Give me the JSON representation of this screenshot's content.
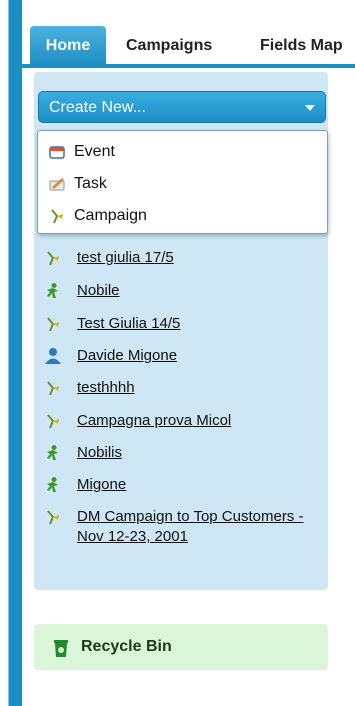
{
  "tabs": [
    {
      "label": "Home"
    },
    {
      "label": "Campaigns"
    },
    {
      "label": "Fields Map"
    }
  ],
  "create_new": {
    "label": "Create New...",
    "options": [
      {
        "label": "Event",
        "icon": "calendar-icon"
      },
      {
        "label": "Task",
        "icon": "task-pencil-icon"
      },
      {
        "label": "Campaign",
        "icon": "campaign-icon"
      }
    ]
  },
  "recent_items": [
    {
      "label": "test giulia 17/5",
      "icon": "campaign-icon"
    },
    {
      "label": "Nobile",
      "icon": "lead-icon"
    },
    {
      "label": "Test Giulia 14/5",
      "icon": "campaign-icon"
    },
    {
      "label": "Davide Migone",
      "icon": "contact-icon"
    },
    {
      "label": "testhhhh",
      "icon": "campaign-icon"
    },
    {
      "label": "Campagna prova Micol",
      "icon": "campaign-icon"
    },
    {
      "label": "Nobilis",
      "icon": "lead-icon"
    },
    {
      "label": "Migone",
      "icon": "lead-icon"
    },
    {
      "label": "DM Campaign to Top Customers - Nov 12-23, 2001",
      "icon": "campaign-icon"
    }
  ],
  "recycle_bin": {
    "label": "Recycle Bin",
    "icon": "trash-icon"
  },
  "colors": {
    "accent": "#1d8fc4",
    "panel": "#cfe7f4",
    "recycle": "#daf5d8"
  }
}
